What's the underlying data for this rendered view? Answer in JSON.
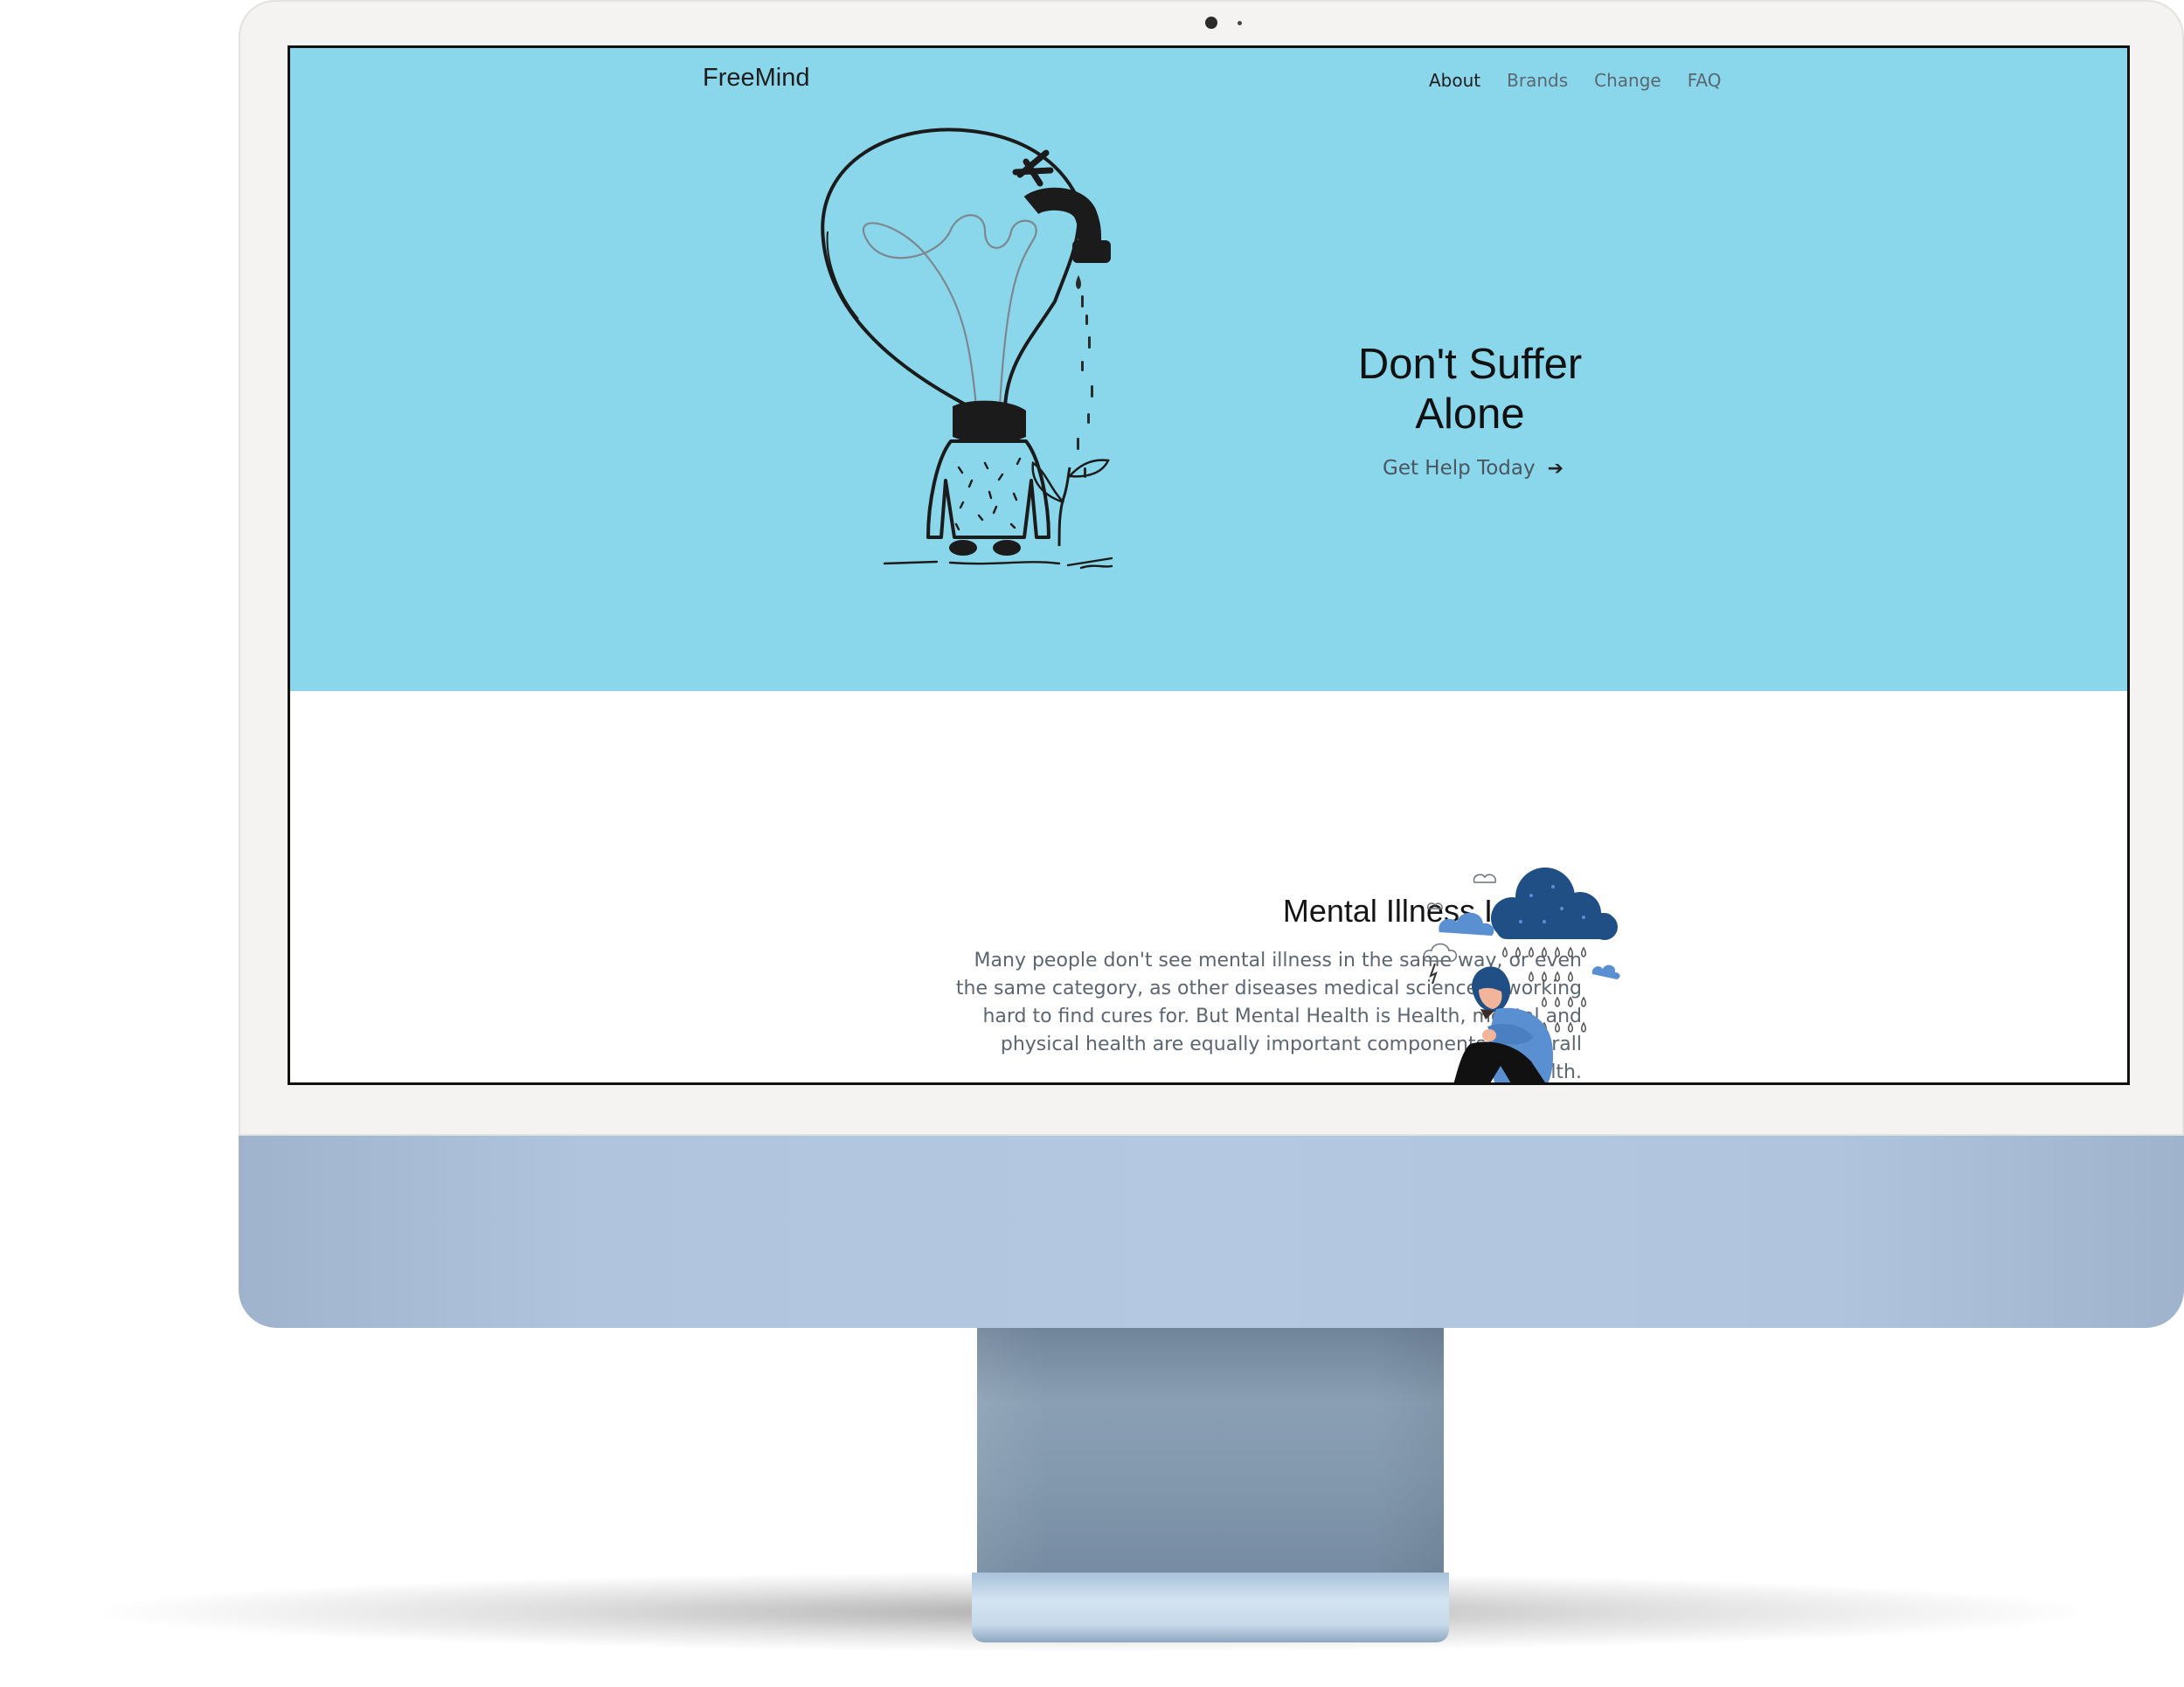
{
  "site": {
    "brand": "FreeMind",
    "nav": [
      {
        "label": "About",
        "active": true
      },
      {
        "label": "Brands",
        "active": false
      },
      {
        "label": "Change",
        "active": false
      },
      {
        "label": "FAQ",
        "active": false
      }
    ]
  },
  "hero": {
    "title": "Don't Suffer Alone",
    "cta_label": "Get Help Today",
    "cta_icon": "arrow-right-icon",
    "background_color": "#8ad7eb",
    "illustration": "lightbulb-head-watering-plant"
  },
  "section": {
    "title": "Mental Illness Is Real",
    "body": "Many people don't see mental illness in the same way, or even the same category, as other diseases medical science is working hard to find cures for. But Mental Health is Health, mental and physical health are equally important components of overall health.",
    "illustration": "sad-person-under-rain-cloud"
  },
  "device": {
    "type": "iMac",
    "chin_color": "#b0c4de"
  }
}
